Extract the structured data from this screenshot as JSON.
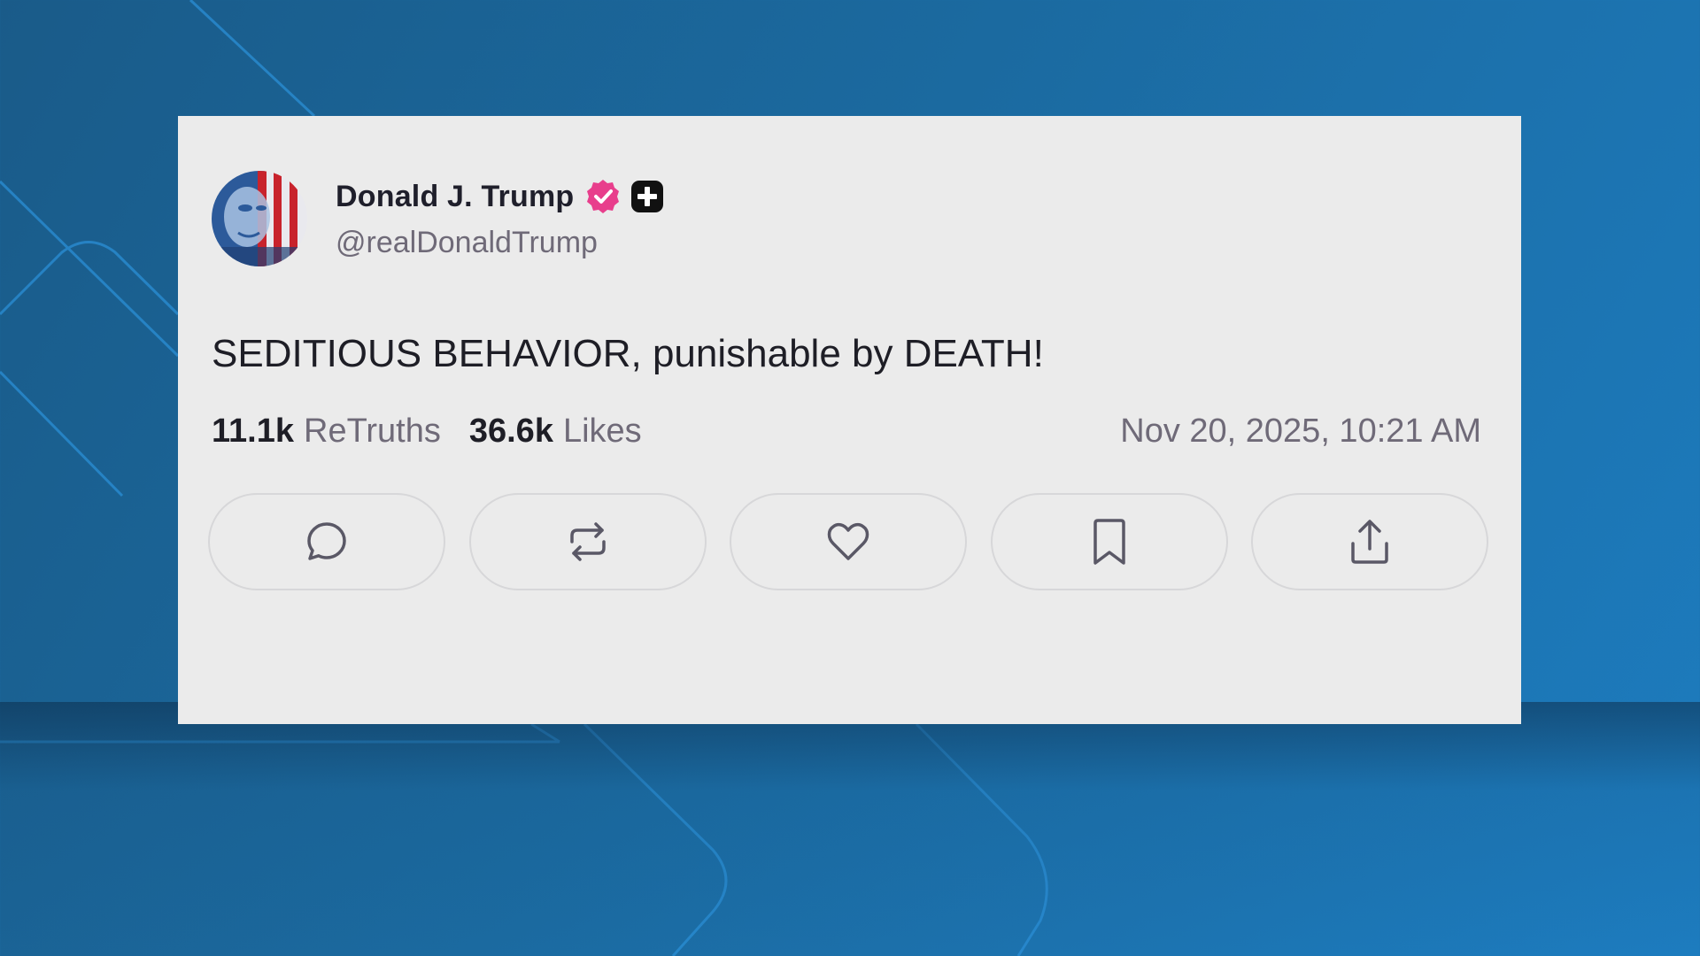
{
  "post": {
    "author": {
      "display_name": "Donald J. Trump",
      "handle": "@realDonaldTrump",
      "verified": true,
      "verified_color": "#e83e8c",
      "plus_badge": true
    },
    "text": "SEDITIOUS BEHAVIOR, punishable by DEATH!",
    "stats": {
      "retruths_count": "11.1k",
      "retruths_label": "ReTruths",
      "likes_count": "36.6k",
      "likes_label": "Likes"
    },
    "timestamp": "Nov 20, 2025, 10:21 AM",
    "actions": [
      {
        "name": "reply",
        "icon": "speech-bubble-icon"
      },
      {
        "name": "retruth",
        "icon": "repost-icon"
      },
      {
        "name": "like",
        "icon": "heart-icon"
      },
      {
        "name": "bookmark",
        "icon": "bookmark-icon"
      },
      {
        "name": "share",
        "icon": "share-upload-icon"
      }
    ]
  },
  "colors": {
    "background": "#1b6aa0",
    "card": "#ebebeb",
    "text_primary": "#1e1e26",
    "text_secondary": "#6f6a78",
    "button_border": "#d7d7d9"
  }
}
